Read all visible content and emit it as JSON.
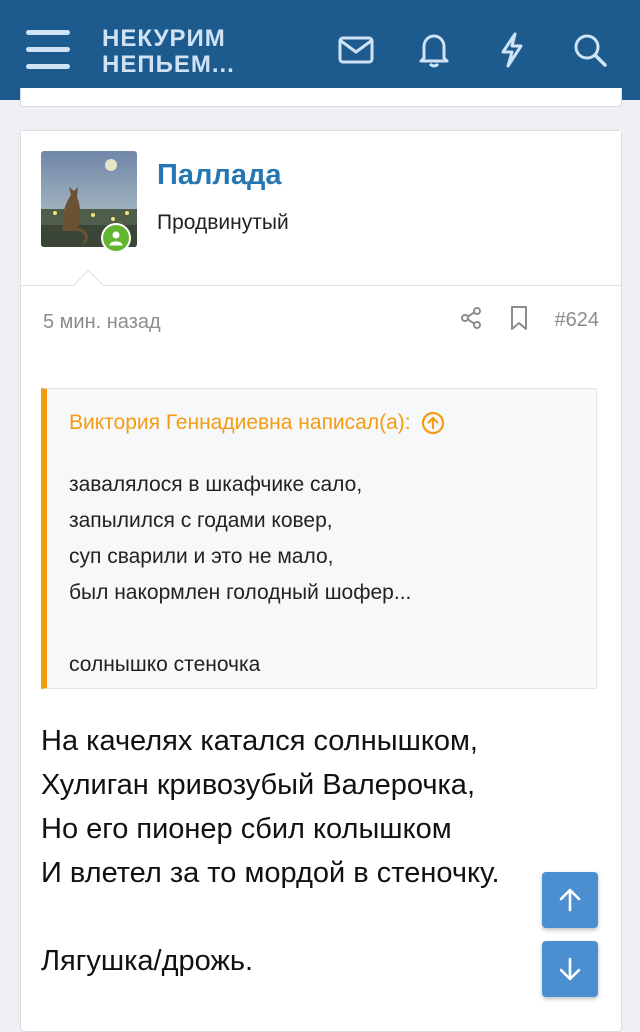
{
  "header": {
    "brand_line1": "НЕКУРИМ",
    "brand_line2": "НЕПЬЕМ...",
    "icons": [
      "menu-icon",
      "envelope-icon",
      "bell-icon",
      "lightning-icon",
      "search-icon"
    ]
  },
  "author": {
    "name": "Паллада",
    "title": "Продвинутый",
    "status": "online"
  },
  "meta": {
    "time": "5 мин. назад",
    "post_number": "#624"
  },
  "quote": {
    "header": "Виктория Геннадиевна написал(а):",
    "lines": [
      "завалялося в шкафчике сало,",
      "запылился с годами ковер,",
      "суп сварили и это не мало,",
      "был накормлен голодный шофер...",
      "",
      "солнышко стеночка"
    ]
  },
  "post": {
    "lines": [
      "На качелях катался солнышком,",
      "Хулиган кривозубый Валерочка,",
      "Но его пионер сбил колышком",
      "И влетел за то мордой в стеночку.",
      "",
      "Лягушка/дрожь."
    ]
  },
  "colors": {
    "header_bg": "#1d5b8f",
    "header_fg": "#cfe3f4",
    "username": "#2577b1",
    "quote_accent": "#f39c12",
    "online": "#63b530",
    "scroll_button": "#4b8fd0"
  }
}
